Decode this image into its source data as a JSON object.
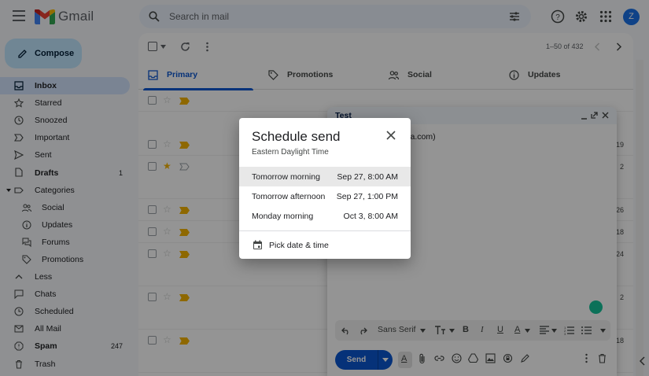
{
  "app": {
    "logo_text": "Gmail",
    "avatar_letter": "Z"
  },
  "search": {
    "placeholder": "Search in mail"
  },
  "sidebar": {
    "compose_label": "Compose",
    "items": [
      {
        "label": "Inbox",
        "icon": "inbox-icon",
        "active": true
      },
      {
        "label": "Starred",
        "icon": "star-icon"
      },
      {
        "label": "Snoozed",
        "icon": "clock-icon"
      },
      {
        "label": "Important",
        "icon": "label-important-icon"
      },
      {
        "label": "Sent",
        "icon": "send-icon"
      },
      {
        "label": "Drafts",
        "icon": "draft-icon",
        "count": "1",
        "bold": true
      },
      {
        "label": "Categories",
        "icon": "label-icon"
      },
      {
        "label": "Social",
        "icon": "people-icon",
        "sub": true
      },
      {
        "label": "Updates",
        "icon": "info-icon",
        "sub": true
      },
      {
        "label": "Forums",
        "icon": "forum-icon",
        "sub": true
      },
      {
        "label": "Promotions",
        "icon": "tag-icon",
        "sub": true
      },
      {
        "label": "Less",
        "icon": "chevron-up-icon"
      },
      {
        "label": "Chats",
        "icon": "chat-icon"
      },
      {
        "label": "Scheduled",
        "icon": "schedule-icon"
      },
      {
        "label": "All Mail",
        "icon": "mail-icon"
      },
      {
        "label": "Spam",
        "icon": "report-icon",
        "count": "247",
        "bold": true
      },
      {
        "label": "Trash",
        "icon": "trash-icon"
      }
    ]
  },
  "toolbar": {
    "pager": "1–50 of 432"
  },
  "tabs": [
    {
      "label": "Primary",
      "icon": "inbox-icon",
      "active": true
    },
    {
      "label": "Promotions",
      "icon": "tag-icon"
    },
    {
      "label": "Social",
      "icon": "people-icon"
    },
    {
      "label": "Updates",
      "icon": "info-icon"
    }
  ],
  "rows": [
    {
      "starred": false,
      "important": true,
      "date": ""
    },
    {
      "starred": false,
      "important": true,
      "date": "19"
    },
    {
      "starred": true,
      "important": false,
      "date": "2"
    },
    {
      "starred": false,
      "important": true,
      "date": "26"
    },
    {
      "starred": false,
      "important": true,
      "date": "18"
    },
    {
      "starred": false,
      "important": true,
      "date": "24"
    },
    {
      "starred": false,
      "important": true,
      "date": "2"
    },
    {
      "starred": false,
      "important": true,
      "date": "18"
    }
  ],
  "compose_window": {
    "title": "Test",
    "to_fragment": "olia.com)",
    "font_name": "Sans Serif",
    "send_label": "Send"
  },
  "schedule_dialog": {
    "title": "Schedule send",
    "timezone": "Eastern Daylight Time",
    "options": [
      {
        "name": "Tomorrow morning",
        "when": "Sep 27, 8:00 AM",
        "highlighted": true
      },
      {
        "name": "Tomorrow afternoon",
        "when": "Sep 27, 1:00 PM"
      },
      {
        "name": "Monday morning",
        "when": "Oct 3, 8:00 AM"
      }
    ],
    "pick_label": "Pick date & time"
  }
}
